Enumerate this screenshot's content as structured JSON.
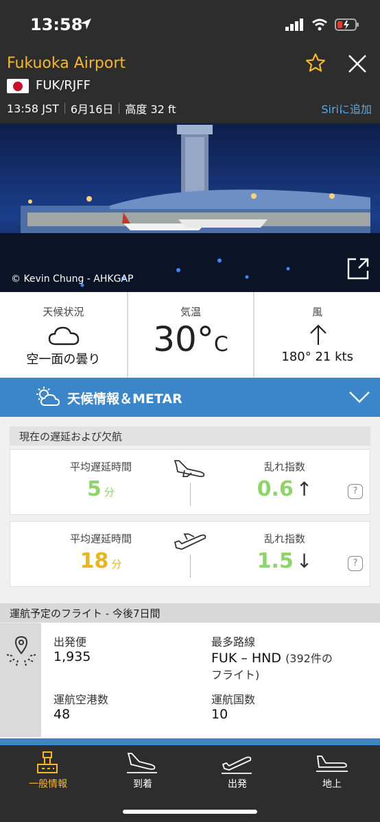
{
  "status_bar": {
    "time": "13:58"
  },
  "header": {
    "airport_name": "Fukuoka Airport",
    "codes": "FUK/RJFF",
    "local_time": "13:58 JST",
    "date": "6月16日",
    "elevation": "高度 32 ft",
    "siri_label": "Siriに追加"
  },
  "photo": {
    "credit": "© Kevin Chung - AHKGAP"
  },
  "weather": {
    "condition_label": "天候状況",
    "condition": "空一面の曇り",
    "temp_label": "気温",
    "temp": "30°",
    "temp_unit": "C",
    "wind_label": "風",
    "wind": "180° 21 kts"
  },
  "metar_bar": {
    "label": "天候情報＆METAR"
  },
  "delays": {
    "section_title": "現在の遅延および欠航",
    "arrivals": {
      "avg_label": "平均遅延時間",
      "avg_value": "5",
      "avg_unit": "分",
      "index_label": "乱れ指数",
      "index_value": "0.6",
      "index_trend": "↑",
      "help": "?"
    },
    "departures": {
      "avg_label": "平均遅延時間",
      "avg_value": "18",
      "avg_unit": "分",
      "index_label": "乱れ指数",
      "index_value": "1.5",
      "index_trend": "↓",
      "help": "?"
    }
  },
  "scheduled": {
    "section_title": "運航予定のフライト - 今後7日間",
    "departures_label": "出発便",
    "departures_value": "1,935",
    "top_route_label": "最多路線",
    "top_route_value": "FUK – HND",
    "top_route_count": "(392件の",
    "top_route_count2": "フライト)",
    "airports_label": "運航空港数",
    "airports_value": "48",
    "countries_label": "運航国数",
    "countries_value": "10"
  },
  "tabs": [
    {
      "label": "一般情報",
      "active": true
    },
    {
      "label": "到着"
    },
    {
      "label": "出発"
    },
    {
      "label": "地上"
    }
  ],
  "colors": {
    "accent": "#f5b82e",
    "blue": "#3a86c8",
    "green": "#8fd36b",
    "orange": "#e8b422"
  }
}
